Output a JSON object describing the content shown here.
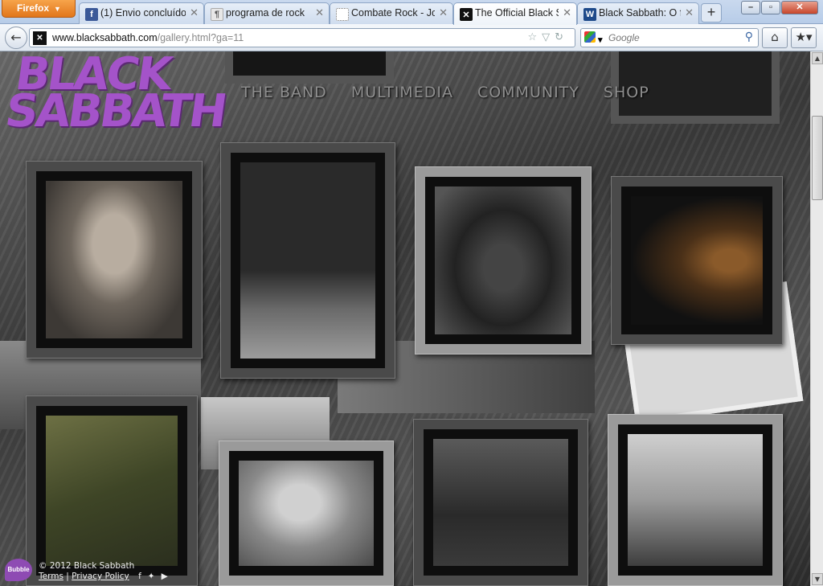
{
  "browser": {
    "menu_label": "Firefox",
    "tabs": [
      {
        "title": "(1) Envio concluído",
        "icon": "facebook-icon",
        "active": false
      },
      {
        "title": "programa de rock",
        "icon": "page-icon",
        "active": false
      },
      {
        "title": "Combate Rock - Jo...",
        "icon": "page-icon",
        "active": false
      },
      {
        "title": "The Official Black S...",
        "icon": "black-sabbath-favicon",
        "active": true
      },
      {
        "title": "Black Sabbath: O fi...",
        "icon": "wordpress-icon",
        "active": false
      }
    ],
    "new_tab_label": "+",
    "url_host": "www.blacksabbath.com",
    "url_path": "/gallery.html?ga=11",
    "search_placeholder": "Google"
  },
  "site": {
    "logo": {
      "line1": "BLACK",
      "line2": "SABBATH",
      "color": "#a453c9"
    },
    "nav": [
      "THE BAND",
      "MULTIMEDIA",
      "COMMUNITY",
      "SHOP"
    ],
    "footer": {
      "copyright": "© 2012 Black Sabbath",
      "terms": "Terms",
      "separator": "|",
      "privacy": "Privacy Policy",
      "social_icons": [
        "facebook-icon",
        "twitter-icon",
        "youtube-icon"
      ]
    },
    "badge": "Bubble"
  },
  "gallery": {
    "photos": [
      {
        "subject": "band-portrait-three-members"
      },
      {
        "subject": "live-concert-stage"
      },
      {
        "subject": "band-group-portrait"
      },
      {
        "subject": "singer-at-microphone"
      },
      {
        "subject": "album-cover-forest"
      },
      {
        "subject": "singer-arms-raised"
      },
      {
        "subject": "band-four-members-standing"
      },
      {
        "subject": "band-with-cross"
      }
    ]
  }
}
